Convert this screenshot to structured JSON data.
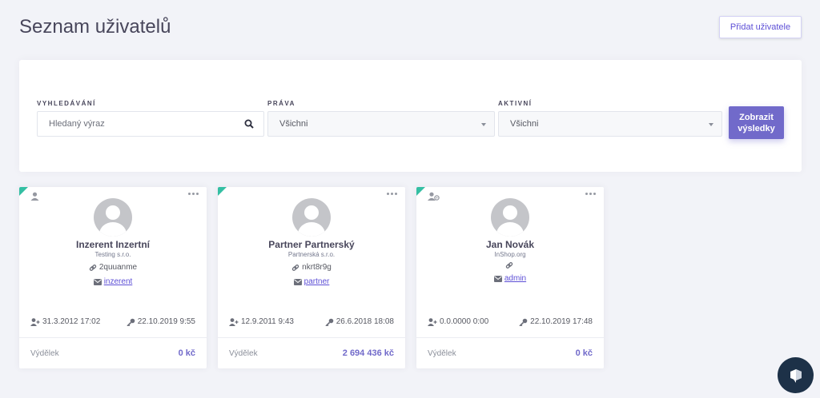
{
  "header": {
    "title": "Seznam uživatelů",
    "add_button": "Přidat uživatele"
  },
  "filters": {
    "search": {
      "label": "VYHLEDÁVÁNÍ",
      "placeholder": "Hledaný výraz",
      "value": ""
    },
    "rights": {
      "label": "PRÁVA",
      "value": "Všichni"
    },
    "active": {
      "label": "AKTIVNÍ",
      "value": "Všichni"
    },
    "submit": {
      "line1": "Zobrazit",
      "line2": "výsledky"
    }
  },
  "cards": [
    {
      "name": "Inzerent Inzertní",
      "company": "Testing s.r.o.",
      "login": "2quuanme",
      "email": "inzerent",
      "created": "31.3.2012 17:02",
      "last_login": "22.10.2019 9:55",
      "earnings_label": "Výdělek",
      "earnings": "0 kč",
      "role_icon": "user-icon"
    },
    {
      "name": "Partner Partnerský",
      "company": "Partnerská s.r.o.",
      "login": "nkrt8r9g",
      "email": "partner",
      "created": "12.9.2011 9:43",
      "last_login": "26.6.2018 18:08",
      "earnings_label": "Výdělek",
      "earnings": "2 694 436 kč",
      "role_icon": "user-icon"
    },
    {
      "name": "Jan Novák",
      "company": "InShop.org",
      "login": "",
      "email": "admin",
      "created": "0.0.0000 0:00",
      "last_login": "22.10.2019 17:48",
      "earnings_label": "Výdělek",
      "earnings": "0 kč",
      "role_icon": "user-admin-icon"
    }
  ],
  "colors": {
    "accent": "#716aca",
    "active_corner": "#34bfa3",
    "chat": "#1d3148"
  }
}
